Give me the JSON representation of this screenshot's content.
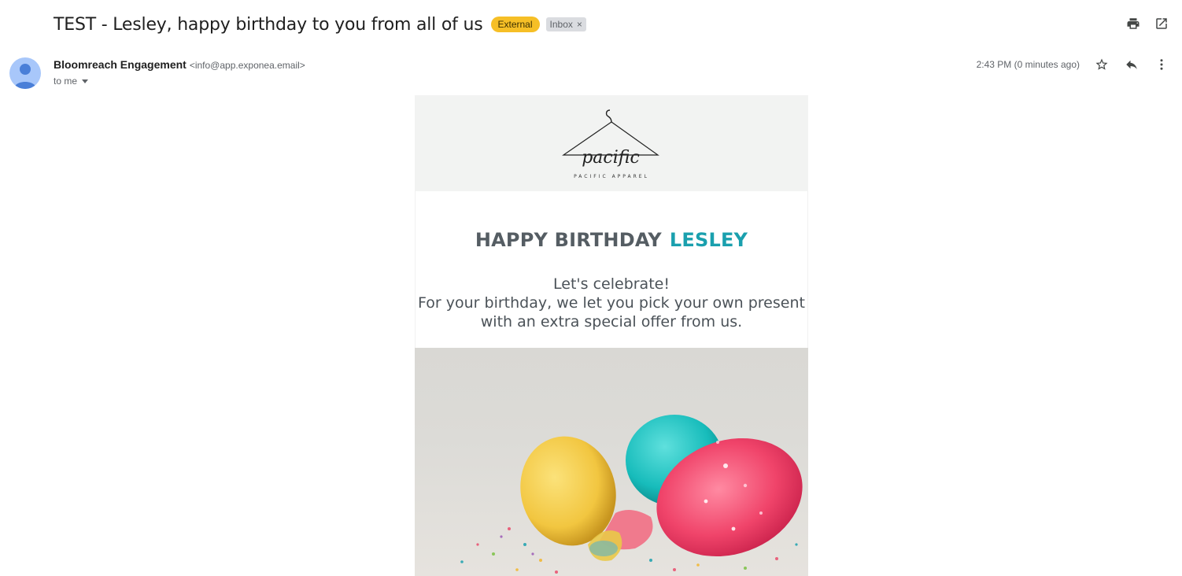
{
  "subject": "TEST - Lesley, happy birthday to you from all of us",
  "labels": {
    "external": "External",
    "inbox": "Inbox",
    "remove": "×"
  },
  "sender": {
    "name": "Bloomreach Engagement",
    "email": "<info@app.exponea.email>"
  },
  "recipient": "to me",
  "timestamp": "2:43 PM (0 minutes ago)",
  "icons": [
    "print-icon",
    "open-in-new-window-icon",
    "star-icon",
    "reply-icon",
    "more-options-icon"
  ],
  "email": {
    "logo_script": "pacific",
    "logo_tagline": "PACIFIC APPAREL",
    "headline_prefix": "HAPPY BIRTHDAY",
    "headline_name": "LESLEY",
    "body_lines": [
      "Let's celebrate!",
      "For your birthday, we let you pick your own present",
      "with an extra special offer from us."
    ]
  },
  "colors": {
    "external_badge": "#f6bf26",
    "accent": "#1aa0ae",
    "headline": "#555d63"
  }
}
